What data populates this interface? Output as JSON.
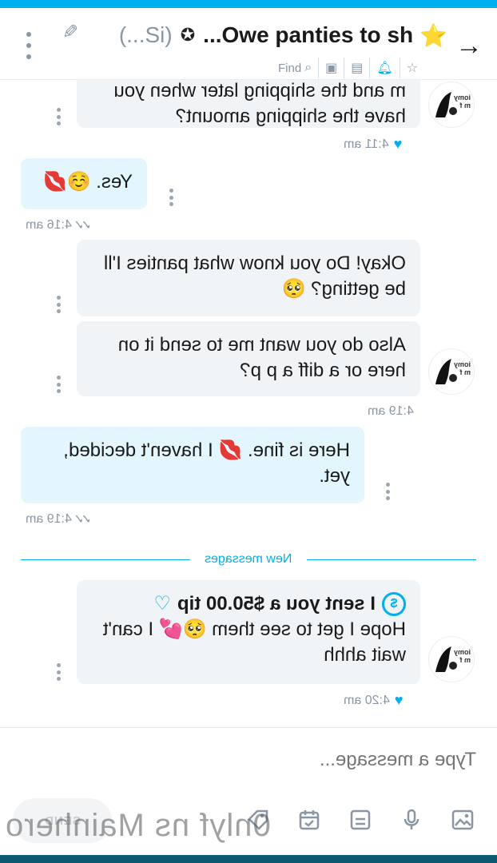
{
  "header": {
    "title": "Owe panties to sh...",
    "subtitle": "(Si...)",
    "find_label": "Find"
  },
  "messages": [
    {
      "id": "m1",
      "direction": "incoming",
      "text": "m and the shipping later when you have the shipping amount?",
      "time": "4:11 am"
    },
    {
      "id": "m2",
      "direction": "outgoing",
      "text": "Yes. ☺️💋",
      "time": "4:16 am"
    },
    {
      "id": "m3",
      "direction": "incoming",
      "text": "Okay! Do you know what panties I'll be getting? 🥺"
    },
    {
      "id": "m4",
      "direction": "incoming",
      "text": "Also do you want me to send it on here or a diff a p p?",
      "time": "4:19 am"
    },
    {
      "id": "m5",
      "direction": "outgoing",
      "text": "Here is fine. 💋 I haven't decided, yet.",
      "time": "4:19 am"
    },
    {
      "id": "m6",
      "direction": "incoming",
      "tip": "I sent you a $50.00 tip",
      "text": "Hope I get to see them 🥺💕 I can't wait ahhh",
      "time": "4:20 am"
    }
  ],
  "divider_label": "New messages",
  "avatar_text": "iomy\nm f",
  "composer": {
    "placeholder": "Type a message...",
    "send_label": "SEND"
  },
  "watermark": "0nlyf ns Mainhero",
  "icons": [
    "back-arrow-icon",
    "star-icon",
    "verified-icon",
    "pencil-icon",
    "bell-icon",
    "image-icon",
    "chat-icon",
    "find-icon",
    "gallery-icon",
    "mic-icon",
    "vault-icon",
    "calendar-icon",
    "tag-icon"
  ],
  "colors": {
    "accent": "#00aff0",
    "incoming_bg": "#f0f4f7",
    "outgoing_bg": "#e3f6fd"
  }
}
